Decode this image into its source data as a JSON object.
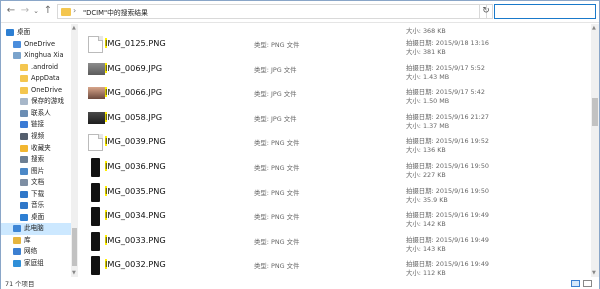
{
  "address": {
    "path": "\"DCIM\"中的搜索结果"
  },
  "nav": {
    "items": [
      {
        "label": "桌面",
        "icon": "desktop-icon",
        "color": "#2d7fd3",
        "indent": 0,
        "selected": false
      },
      {
        "label": "OneDrive",
        "icon": "cloud-icon",
        "color": "#4a8ddc",
        "indent": 1,
        "selected": false
      },
      {
        "label": "Xinghua Xia",
        "icon": "user-icon",
        "color": "#7aa3cc",
        "indent": 1,
        "selected": false
      },
      {
        "label": ".android",
        "icon": "folder-icon",
        "color": "#f4c64f",
        "indent": 2,
        "selected": false
      },
      {
        "label": "AppData",
        "icon": "folder-icon",
        "color": "#f4c64f",
        "indent": 2,
        "selected": false
      },
      {
        "label": "OneDrive",
        "icon": "folder-icon",
        "color": "#f4c64f",
        "indent": 2,
        "selected": false
      },
      {
        "label": "保存的游戏",
        "icon": "games-folder-icon",
        "color": "#a7b7c9",
        "indent": 2,
        "selected": false
      },
      {
        "label": "联系人",
        "icon": "contacts-icon",
        "color": "#6b8db3",
        "indent": 2,
        "selected": false
      },
      {
        "label": "链接",
        "icon": "links-icon",
        "color": "#3a7bd5",
        "indent": 2,
        "selected": false
      },
      {
        "label": "视频",
        "icon": "videos-icon",
        "color": "#555f6e",
        "indent": 2,
        "selected": false
      },
      {
        "label": "收藏夹",
        "icon": "favorites-icon",
        "color": "#f2b630",
        "indent": 2,
        "selected": false
      },
      {
        "label": "搜索",
        "icon": "search-icon",
        "color": "#6d7f93",
        "indent": 2,
        "selected": false
      },
      {
        "label": "图片",
        "icon": "pictures-icon",
        "color": "#4b88c7",
        "indent": 2,
        "selected": false
      },
      {
        "label": "文档",
        "icon": "documents-icon",
        "color": "#7d8ea3",
        "indent": 2,
        "selected": false
      },
      {
        "label": "下载",
        "icon": "downloads-icon",
        "color": "#2f77c9",
        "indent": 2,
        "selected": false
      },
      {
        "label": "音乐",
        "icon": "music-icon",
        "color": "#2f77c9",
        "indent": 2,
        "selected": false
      },
      {
        "label": "桌面",
        "icon": "desktop-icon",
        "color": "#2d7fd3",
        "indent": 2,
        "selected": false
      },
      {
        "label": "此电脑",
        "icon": "computer-icon",
        "color": "#3e86d6",
        "indent": 1,
        "selected": true
      },
      {
        "label": "库",
        "icon": "libraries-icon",
        "color": "#e6b53e",
        "indent": 1,
        "selected": false
      },
      {
        "label": "网络",
        "icon": "network-icon",
        "color": "#3c7fd1",
        "indent": 1,
        "selected": false
      },
      {
        "label": "家庭组",
        "icon": "homegroup-icon",
        "color": "#2f8fd8",
        "indent": 1,
        "selected": false
      }
    ]
  },
  "results": {
    "first_size": "大小: 368 KB",
    "rows": [
      {
        "name_hl": "I",
        "name_rest": "MG_0125.PNG",
        "type": "类型: PNG 文件",
        "date": "拍摄日期: 2015/9/18 13:16",
        "size": "大小: 381 KB",
        "thumb": "png-doc"
      },
      {
        "name_hl": "I",
        "name_rest": "MG_0069.JPG",
        "type": "类型: JPG 文件",
        "date": "拍摄日期: 2015/9/17 5:52",
        "size": "大小: 1.43 MB",
        "thumb": "photo-sky"
      },
      {
        "name_hl": "I",
        "name_rest": "MG_0066.JPG",
        "type": "类型: JPG 文件",
        "date": "拍摄日期: 2015/9/17 5:42",
        "size": "大小: 1.50 MB",
        "thumb": "photo-sunset"
      },
      {
        "name_hl": "I",
        "name_rest": "MG_0058.JPG",
        "type": "类型: JPG 文件",
        "date": "拍摄日期: 2015/9/16 21:27",
        "size": "大小: 1.37 MB",
        "thumb": "photo-dark"
      },
      {
        "name_hl": "I",
        "name_rest": "MG_0039.PNG",
        "type": "类型: PNG 文件",
        "date": "拍摄日期: 2015/9/16 19:52",
        "size": "大小: 136 KB",
        "thumb": "png-doc"
      },
      {
        "name_hl": "I",
        "name_rest": "MG_0036.PNG",
        "type": "类型: PNG 文件",
        "date": "拍摄日期: 2015/9/16 19:50",
        "size": "大小: 227 KB",
        "thumb": "phone"
      },
      {
        "name_hl": "I",
        "name_rest": "MG_0035.PNG",
        "type": "类型: PNG 文件",
        "date": "拍摄日期: 2015/9/16 19:50",
        "size": "大小: 35.9 KB",
        "thumb": "phone"
      },
      {
        "name_hl": "I",
        "name_rest": "MG_0034.PNG",
        "type": "类型: PNG 文件",
        "date": "拍摄日期: 2015/9/16 19:49",
        "size": "大小: 142 KB",
        "thumb": "phone"
      },
      {
        "name_hl": "I",
        "name_rest": "MG_0033.PNG",
        "type": "类型: PNG 文件",
        "date": "拍摄日期: 2015/9/16 19:49",
        "size": "大小: 143 KB",
        "thumb": "phone"
      },
      {
        "name_hl": "I",
        "name_rest": "MG_0032.PNG",
        "type": "类型: PNG 文件",
        "date": "拍摄日期: 2015/9/16 19:49",
        "size": "大小: 112 KB",
        "thumb": "phone"
      }
    ]
  },
  "status": {
    "count": "71 个项目"
  },
  "colors": {
    "highlight": "#ffef00",
    "selection": "#cce8ff",
    "accent": "#1979ca"
  }
}
